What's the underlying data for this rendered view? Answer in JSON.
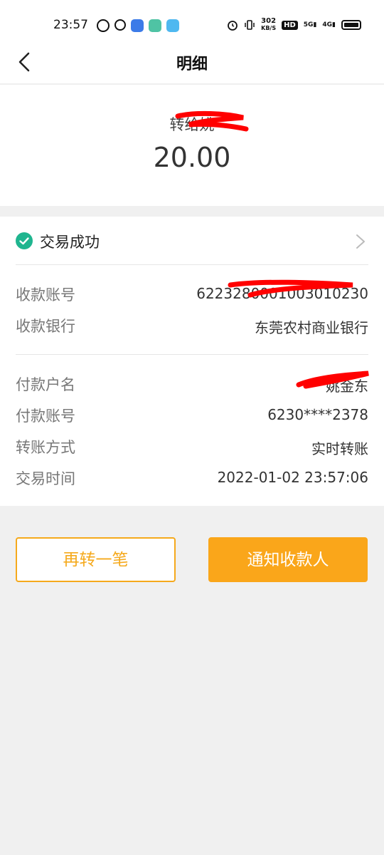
{
  "status_bar": {
    "time": "23:57",
    "net_speed_value": "302",
    "net_speed_unit": "KB/S",
    "hd_label": "HD",
    "signal_1": "5G",
    "signal_2": "4G"
  },
  "header": {
    "title": "明细"
  },
  "transfer": {
    "recipient_prefix": "转给姚",
    "amount": "20.00"
  },
  "details": {
    "status": "交易成功",
    "receiver_account_label": "收款账号",
    "receiver_account_value": "6223280001003010230",
    "receiver_bank_label": "收款银行",
    "receiver_bank_value": "东莞农村商业银行",
    "payer_name_label": "付款户名",
    "payer_name_value": "姚金东",
    "payer_account_label": "付款账号",
    "payer_account_value": "6230****2378",
    "transfer_method_label": "转账方式",
    "transfer_method_value": "实时转账",
    "transaction_time_label": "交易时间",
    "transaction_time_value": "2022-01-02 23:57:06"
  },
  "actions": {
    "transfer_again": "再转一笔",
    "notify_receiver": "通知收款人"
  },
  "colors": {
    "accent": "#faa61a",
    "success": "#1fb58f",
    "redaction": "#ff0000"
  },
  "icons": {
    "back": "back-icon",
    "success": "check-circle-icon",
    "chevron": "chevron-right-icon"
  }
}
